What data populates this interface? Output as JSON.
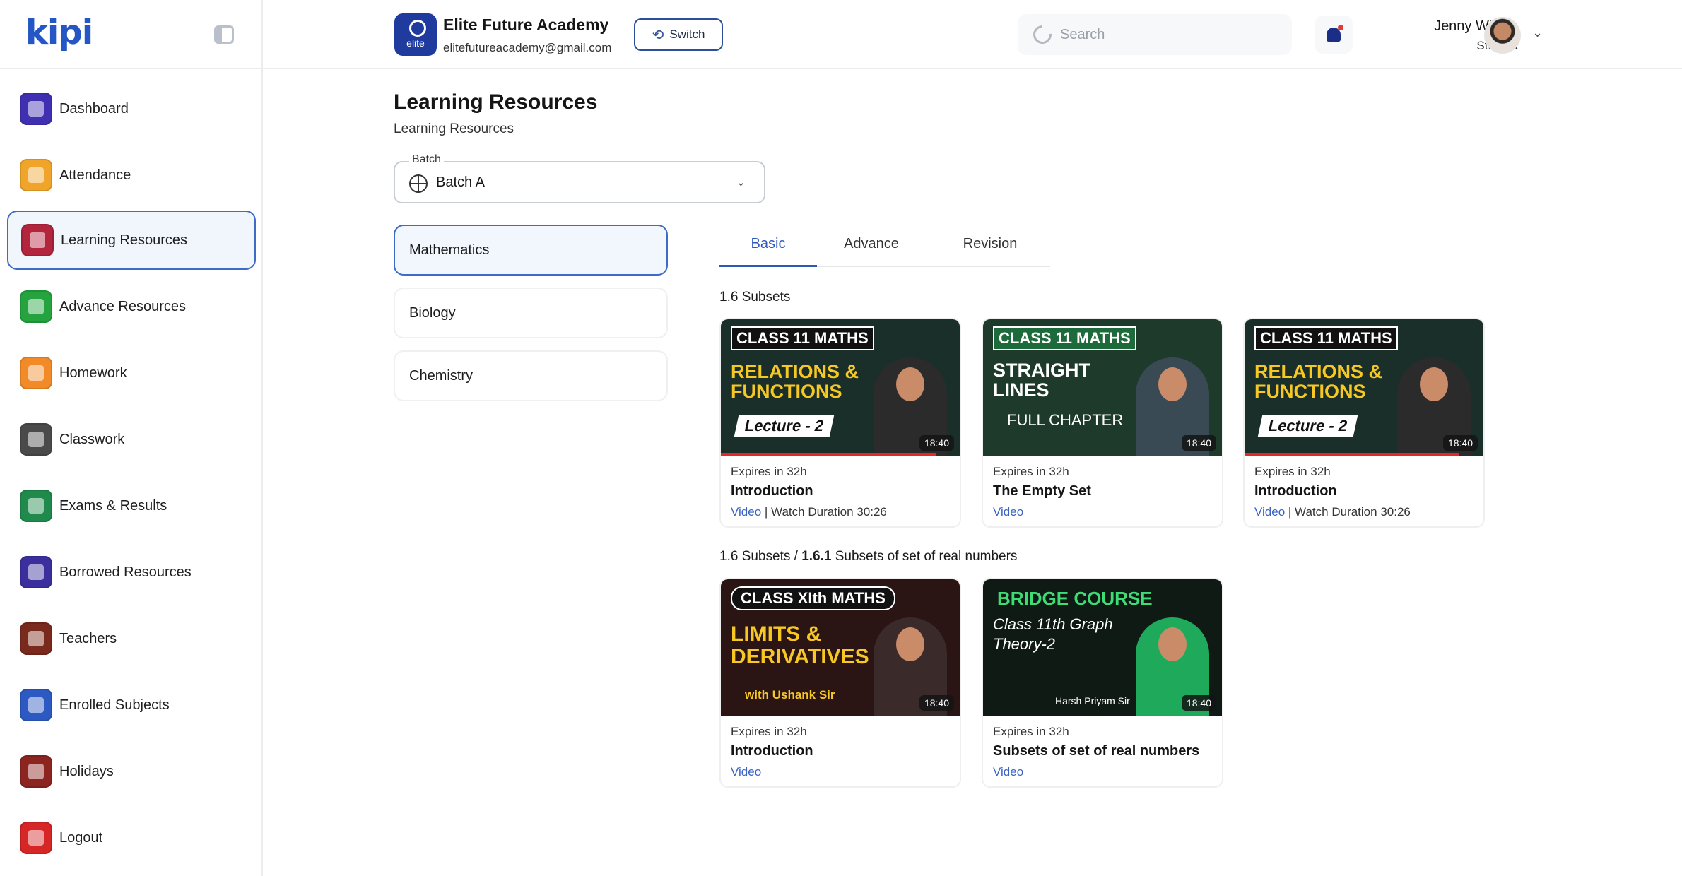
{
  "sidebar": {
    "logo": "kipi",
    "items": [
      {
        "label": "Dashboard",
        "icon": "dashboard-icon",
        "color": "#3f2fb1"
      },
      {
        "label": "Attendance",
        "icon": "attendance-icon",
        "color": "#f0a52a"
      },
      {
        "label": "Learning Resources",
        "icon": "learning-resources-icon",
        "color": "#b3243d"
      },
      {
        "label": "Advance Resources",
        "icon": "advance-resources-icon",
        "color": "#25a33f"
      },
      {
        "label": "Homework",
        "icon": "homework-icon",
        "color": "#f28b27"
      },
      {
        "label": "Classwork",
        "icon": "classwork-icon",
        "color": "#4a4a4a"
      },
      {
        "label": "Exams & Results",
        "icon": "exams-results-icon",
        "color": "#1f8a4c"
      },
      {
        "label": "Borrowed Resources",
        "icon": "borrowed-resources-icon",
        "color": "#3b2f9e"
      },
      {
        "label": "Teachers",
        "icon": "teachers-icon",
        "color": "#7a2a1c"
      },
      {
        "label": "Enrolled Subjects",
        "icon": "enrolled-subjects-icon",
        "color": "#2d5ac2"
      },
      {
        "label": "Holidays",
        "icon": "holidays-icon",
        "color": "#8c2420"
      },
      {
        "label": "Logout",
        "icon": "logout-icon",
        "color": "#d62626"
      }
    ],
    "active_index": 2
  },
  "header": {
    "academy_logo_text": "elite",
    "academy_name": "Elite Future Academy",
    "academy_email": "elitefutureacademy@gmail.com",
    "switch_label": "Switch",
    "search_placeholder": "Search",
    "user_name": "Jenny Wilson",
    "user_role": "Student"
  },
  "main": {
    "title": "Learning Resources",
    "subtitle": "Learning Resources",
    "batch": {
      "legend": "Batch",
      "value": "Batch A"
    },
    "subjects": [
      "Mathematics",
      "Biology",
      "Chemistry"
    ],
    "active_subject": 0,
    "tabs": [
      "Basic",
      "Advance",
      "Revision"
    ],
    "active_tab": 0,
    "sections": [
      {
        "label": "1.6  Subsets",
        "cards": [
          {
            "thumb": {
              "line1": "CLASS 11 MATHS",
              "line2": "RELATIONS & FUNCTIONS",
              "line3": "Lecture - 2",
              "bg": "#1a2f2a"
            },
            "duration": "18:40",
            "expires": "Expires in 32h",
            "title": "Introduction",
            "type": "Video",
            "watch": "| Watch Duration 30:26",
            "progress": 0.9
          },
          {
            "thumb": {
              "line1": "CLASS 11 MATHS",
              "line2": "STRAIGHT LINES",
              "line3": "FULL CHAPTER",
              "bg": "#1e3a2a"
            },
            "duration": "18:40",
            "expires": "Expires in 32h",
            "title": "The Empty Set",
            "type": "Video",
            "watch": "",
            "progress": 0
          },
          {
            "thumb": {
              "line1": "CLASS 11 MATHS",
              "line2": "RELATIONS & FUNCTIONS",
              "line3": "Lecture - 2",
              "bg": "#1a2f2a"
            },
            "duration": "18:40",
            "expires": "Expires in 32h",
            "title": "Introduction",
            "type": "Video",
            "watch": "| Watch Duration 30:26",
            "progress": 0.9
          }
        ]
      },
      {
        "label_prefix": "1.6  Subsets / ",
        "label_bold": "1.6.1",
        "label_suffix": "  Subsets of set of real numbers",
        "cards": [
          {
            "thumb": {
              "line1": "CLASS XIth MATHS",
              "line2": "LIMITS & DERIVATIVES",
              "line3": "with Ushank Sir",
              "bg": "#2a1414"
            },
            "duration": "18:40",
            "expires": "Expires in 32h",
            "title": "Introduction",
            "type": "Video",
            "watch": "",
            "progress": 0
          },
          {
            "thumb": {
              "line1": "BRIDGE COURSE",
              "line2": "Class 11th Graph Theory-2",
              "line3": "Harsh Priyam Sir",
              "bg": "#0f1a14"
            },
            "duration": "18:40",
            "expires": "Expires in 32h",
            "title": "Subsets of set of real numbers",
            "type": "Video",
            "watch": "",
            "progress": 0
          }
        ]
      }
    ]
  }
}
